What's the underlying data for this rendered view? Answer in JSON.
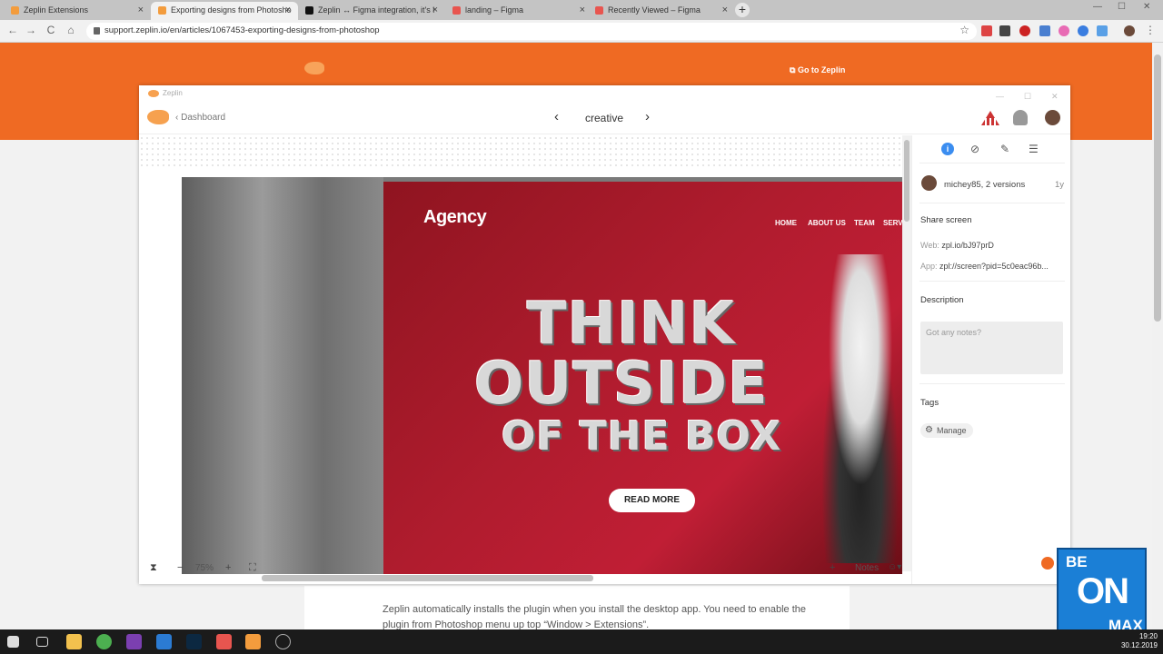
{
  "browser": {
    "tabs": [
      {
        "title": "Zeplin Extensions",
        "favicon_color": "#f39c3d"
      },
      {
        "title": "Exporting designs from Photosho",
        "favicon_color": "#f39c3d"
      },
      {
        "title": "Zeplin ↔ Figma integration, it's l",
        "favicon_color": "#111111"
      },
      {
        "title": "landing – Figma",
        "favicon_color": "#e8554f"
      },
      {
        "title": "Recently Viewed – Figma",
        "favicon_color": "#e8554f"
      }
    ],
    "close_glyph": "×",
    "new_tab_glyph": "+",
    "url": "support.zeplin.io/en/articles/1067453-exporting-designs-from-photoshop",
    "nav": {
      "back": "←",
      "forward": "→",
      "reload": "C",
      "home": "⌂",
      "star": "☆",
      "menu": "⋮"
    }
  },
  "site": {
    "go_to_zeplin": "Go to Zeplin",
    "brand_color": "#ef6a23",
    "article_text": "Zeplin automatically installs the plugin when you install the desktop app. You need to enable the plugin from Photoshop menu up top “Window > Extensions”."
  },
  "zeplin": {
    "window_title": "Zeplin",
    "window_controls": {
      "minimize": "—",
      "maximize": "☐",
      "close": "✕"
    },
    "back_label": "Dashboard",
    "screen_name": "creative",
    "prev_glyph": "‹",
    "next_glyph": "›",
    "design": {
      "brand": "Agency",
      "nav": [
        "HOME",
        "ABOUT US",
        "TEAM",
        "SERVI"
      ],
      "headline_1": "THINK",
      "headline_2": "OUTSIDE",
      "headline_3": "OF THE BOX",
      "cta": "READ MORE"
    },
    "bottom": {
      "zoom": "75%",
      "plus": "+",
      "minus": "−",
      "notes": "Notes"
    },
    "sidebar": {
      "author": "michey85, 2 versions",
      "age": "1y",
      "share_heading": "Share screen",
      "web_label": "Web:",
      "web_value": "zpl.io/bJ97prD",
      "app_label": "App:",
      "app_value": "zpl://screen?pid=5c0eac96b...",
      "description_heading": "Description",
      "notes_placeholder": "Got any notes?",
      "tags_heading": "Tags",
      "manage_label": "Manage",
      "info_glyph": "i"
    }
  },
  "taskbar": {
    "time": "19:20",
    "date": "30.12.2019"
  },
  "overlay": {
    "be": "BE",
    "on": "ON",
    "max": "MAX"
  }
}
